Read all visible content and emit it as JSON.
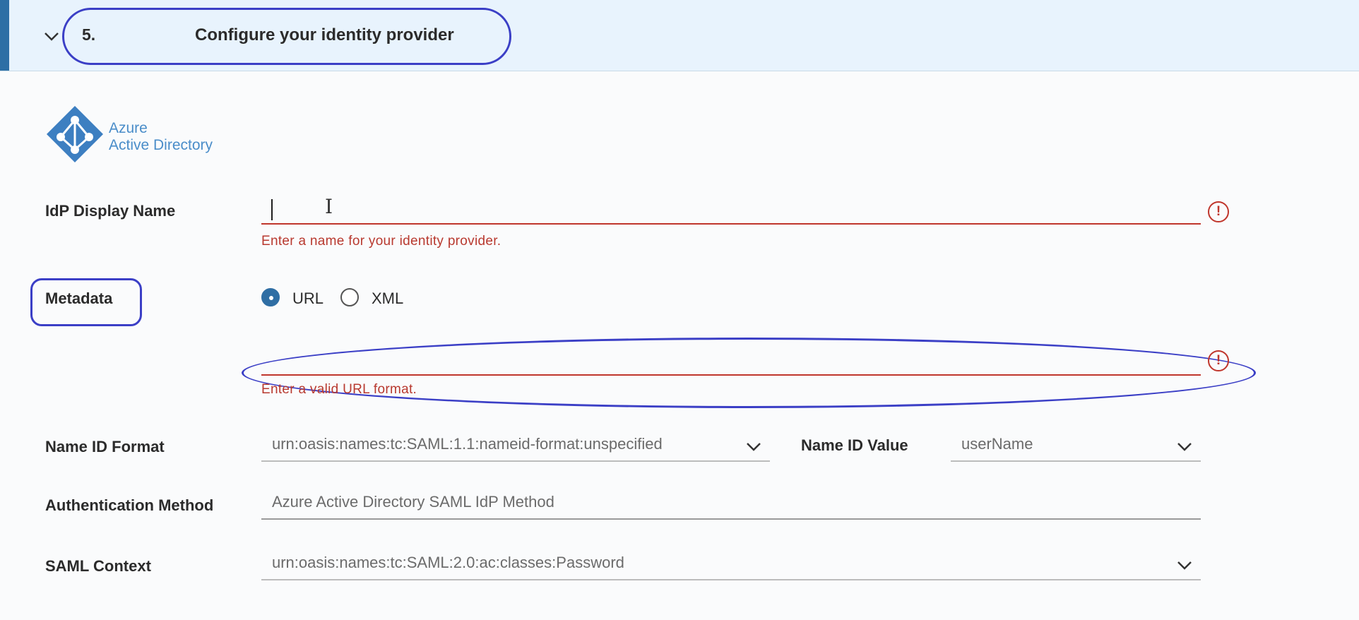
{
  "header": {
    "step_number": "5.",
    "title": "Configure your identity provider"
  },
  "logo": {
    "line1": "Azure",
    "line2": "Active Directory",
    "color": "#4a8dc9"
  },
  "form": {
    "idp_display_name": {
      "label": "IdP Display Name",
      "value": "",
      "error": "Enter a name for your identity provider."
    },
    "metadata": {
      "label": "Metadata",
      "options": [
        "URL",
        "XML"
      ],
      "selected": "URL",
      "url_value": "",
      "error": "Enter a valid URL format."
    },
    "name_id_format": {
      "label": "Name ID Format",
      "value": "urn:oasis:names:tc:SAML:1.1:nameid-format:unspecified"
    },
    "name_id_value": {
      "label": "Name ID Value",
      "value": "userName"
    },
    "authentication_method": {
      "label": "Authentication Method",
      "value": "Azure Active Directory SAML IdP Method"
    },
    "saml_context": {
      "label": "SAML Context",
      "value": "urn:oasis:names:tc:SAML:2.0:ac:classes:Password"
    }
  },
  "colors": {
    "accent": "#2d6fa5",
    "error": "#c0362c",
    "annotation": "#3b3fc6",
    "header_bg": "#e8f3fd"
  },
  "icons": {
    "toggle": "chevron-down-icon",
    "error": "exclamation-circle-icon",
    "dropdown": "chevron-down-icon"
  }
}
